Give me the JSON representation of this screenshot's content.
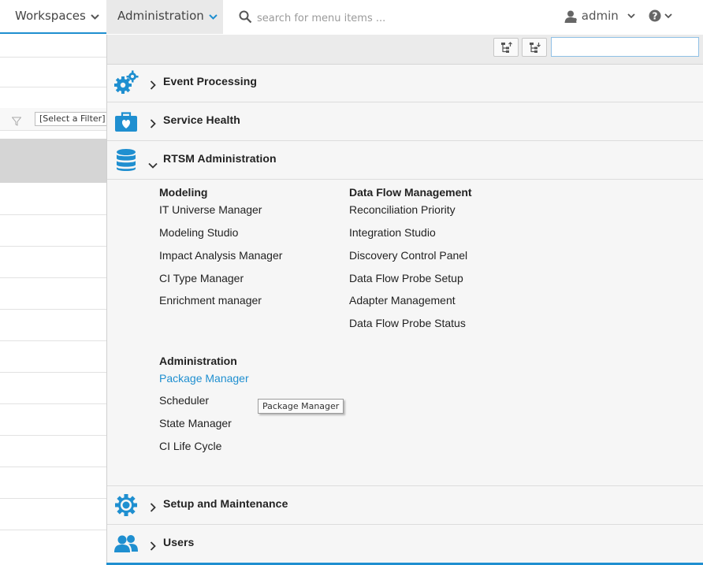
{
  "nav": {
    "workspaces_label": "Workspaces",
    "administration_label": "Administration",
    "search_placeholder": "search for menu items ...",
    "user_label": "admin"
  },
  "left_panel": {
    "filter_label": "[Select a Filter]"
  },
  "menu": {
    "filter_value": "",
    "sections": {
      "event_processing": {
        "title": "Event Processing",
        "icon": "gears-icon"
      },
      "service_health": {
        "title": "Service Health",
        "icon": "medical-kit-icon"
      },
      "rtsm": {
        "title": "RTSM Administration",
        "icon": "database-icon",
        "groups": {
          "modeling": {
            "title": "Modeling",
            "items": [
              "IT Universe Manager",
              "Modeling Studio",
              "Impact Analysis Manager",
              "CI Type Manager",
              "Enrichment manager"
            ]
          },
          "data_flow": {
            "title": "Data Flow Management",
            "items": [
              "Reconciliation Priority",
              "Integration Studio",
              "Discovery Control Panel",
              "Data Flow Probe Setup",
              "Adapter Management",
              "Data Flow Probe Status"
            ]
          },
          "administration": {
            "title": "Administration",
            "items": [
              "Package Manager",
              "Scheduler",
              "State Manager",
              "CI Life Cycle"
            ]
          }
        }
      },
      "setup": {
        "title": "Setup and Maintenance",
        "icon": "gear-icon"
      },
      "users": {
        "title": "Users",
        "icon": "users-icon"
      }
    }
  },
  "tooltip": "Package Manager",
  "colors": {
    "accent": "#1f8fd0",
    "icon_blue": "#1f8fd0",
    "menu_bg": "#f6f6f6"
  }
}
